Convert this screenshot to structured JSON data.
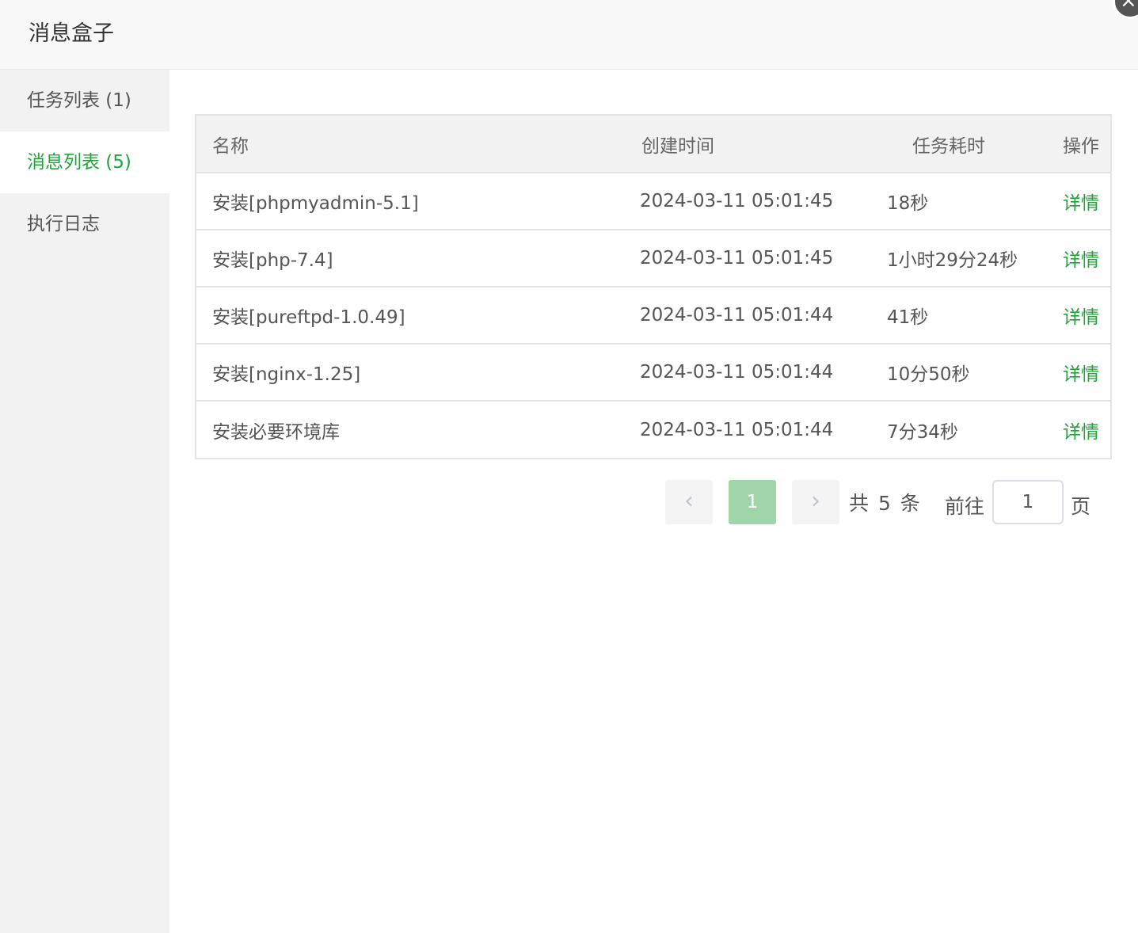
{
  "header": {
    "title": "消息盒子",
    "close_icon": "×"
  },
  "sidebar": {
    "items": [
      {
        "label": "任务列表 (1)",
        "active": false
      },
      {
        "label": "消息列表 (5)",
        "active": true
      },
      {
        "label": "执行日志",
        "active": false
      }
    ]
  },
  "table": {
    "columns": [
      "名称",
      "创建时间",
      "任务耗时",
      "操作"
    ],
    "rows": [
      {
        "name": "安装[phpmyadmin-5.1]",
        "created": "2024-03-11 05:01:45",
        "duration": "18秒",
        "action": "详情"
      },
      {
        "name": "安装[php-7.4]",
        "created": "2024-03-11 05:01:45",
        "duration": "1小时29分24秒",
        "action": "详情"
      },
      {
        "name": "安装[pureftpd-1.0.49]",
        "created": "2024-03-11 05:01:44",
        "duration": "41秒",
        "action": "详情"
      },
      {
        "name": "安装[nginx-1.25]",
        "created": "2024-03-11 05:01:44",
        "duration": "10分50秒",
        "action": "详情"
      },
      {
        "name": "安装必要环境库",
        "created": "2024-03-11 05:01:44",
        "duration": "7分34秒",
        "action": "详情"
      }
    ]
  },
  "pagination": {
    "prev_icon": "‹",
    "current_page": "1",
    "next_icon": "›",
    "total_text": "共 5 条",
    "goto_label": "前往",
    "goto_value": "1",
    "page_unit": "页"
  },
  "colors": {
    "accent": "#20a53a",
    "sidebar_bg": "#f2f2f2",
    "header_bg": "#f8f8f8"
  }
}
